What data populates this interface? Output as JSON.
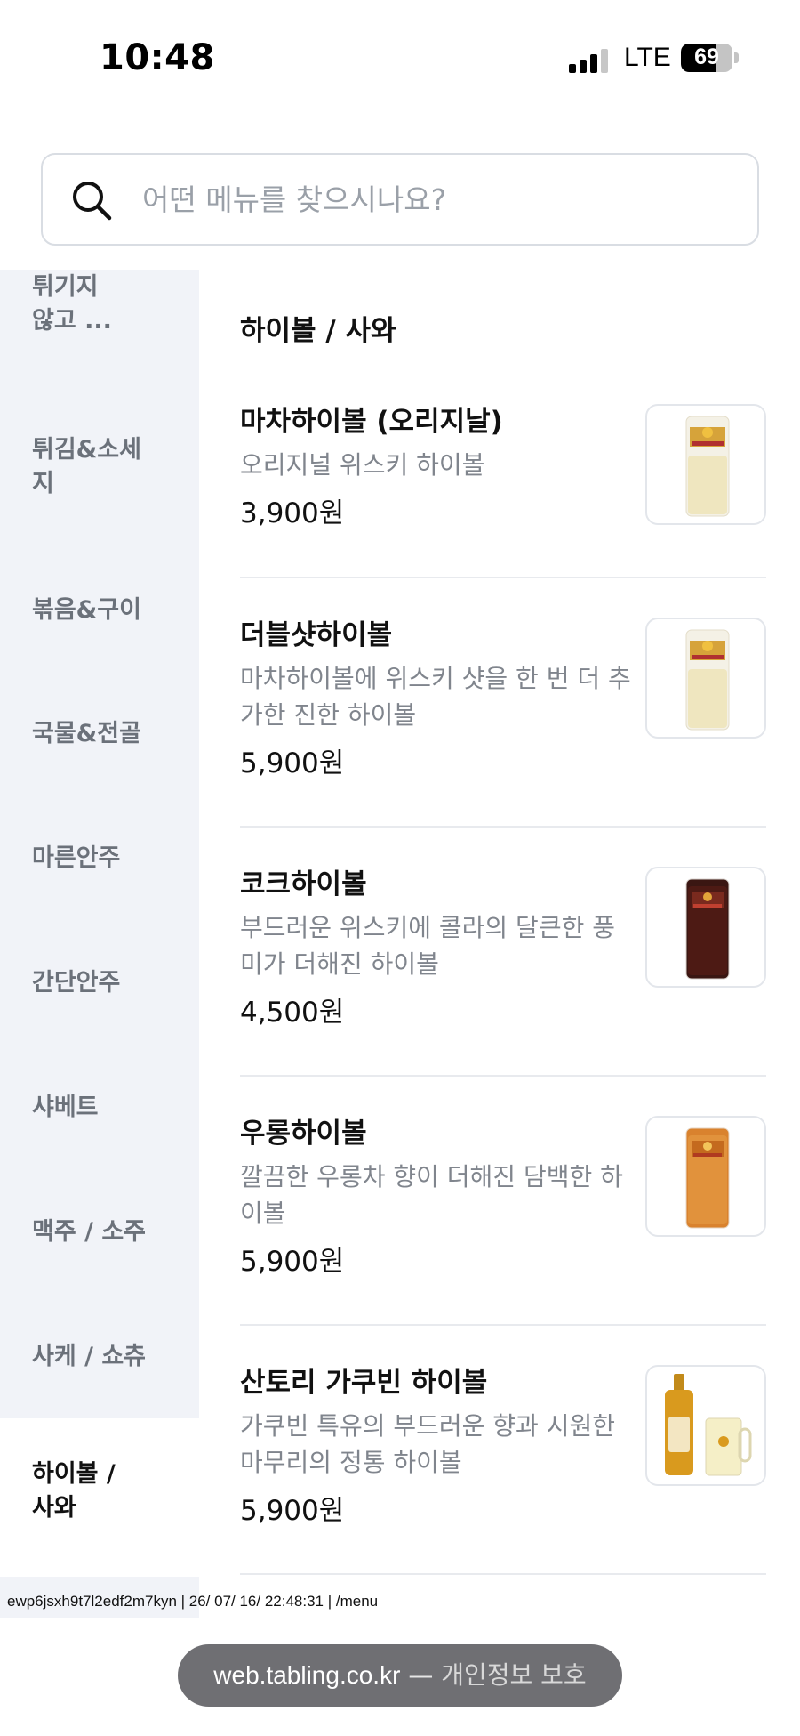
{
  "status_bar": {
    "time": "10:48",
    "network": "LTE",
    "battery": "69",
    "battery_level_percent": 69
  },
  "search": {
    "placeholder": "어떤 메뉴를 찾으시나요?",
    "icon": "search-icon"
  },
  "sidebar": {
    "items": [
      {
        "label": "튀기지\n않고 ...",
        "active": false
      },
      {
        "label": "튀김&소세\n지",
        "active": false
      },
      {
        "label": "볶음&구이",
        "active": false
      },
      {
        "label": "국물&전골",
        "active": false
      },
      {
        "label": "마른안주",
        "active": false
      },
      {
        "label": "간단안주",
        "active": false
      },
      {
        "label": "샤베트",
        "active": false
      },
      {
        "label": "맥주 / 소주",
        "active": false
      },
      {
        "label": "사케 / 쇼츄",
        "active": false
      },
      {
        "label": "하이볼 /\n사와",
        "active": true
      }
    ]
  },
  "section": {
    "title": "하이볼 / 사와"
  },
  "menu_items": [
    {
      "name": "마차하이볼 (오리지날)",
      "desc": "오리지널 위스키 하이볼",
      "price": "3,900원",
      "image": "highball-glass-image"
    },
    {
      "name": "더블샷하이볼",
      "desc": "마차하이볼에 위스키 샷을 한 번 더 추가한 진한 하이볼",
      "price": "5,900원",
      "image": "highball-glass-image"
    },
    {
      "name": "코크하이볼",
      "desc": "부드러운 위스키에 콜라의 달큰한 풍미가 더해진 하이볼",
      "price": "4,500원",
      "image": "coke-highball-image"
    },
    {
      "name": "우롱하이볼",
      "desc": "깔끔한 우롱차 향이 더해진 담백한 하이볼",
      "price": "5,900원",
      "image": "oolong-highball-image"
    },
    {
      "name": "산토리 가쿠빈 하이볼",
      "desc": "가쿠빈 특유의 부드러운 향과 시원한 마무리의 정통 하이볼",
      "price": "5,900원",
      "image": "kakubin-bottle-image"
    }
  ],
  "footer": {
    "debug_line": "ewp6jsxh9t7l2edf2m7kyn | 26/ 07/ 16/ 22:48:31 | /menu",
    "url_domain": "web.tabling.co.kr",
    "url_separator": "—",
    "url_note": "개인정보 보호"
  },
  "colors": {
    "sidebar_bg": "#f1f3f8",
    "inactive_text": "#6b717a",
    "desc_text": "#80858d",
    "pill_bg": "#6f6f73"
  }
}
